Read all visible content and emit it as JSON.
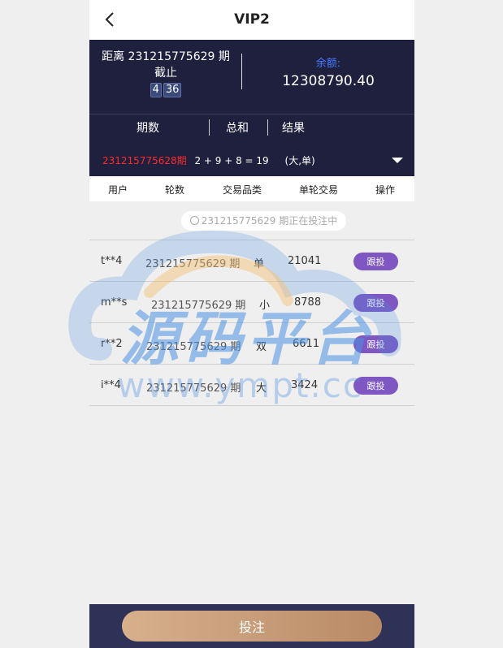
{
  "header": {
    "title": "VIP2"
  },
  "info": {
    "countdown_line1": "距离 231215775629 期",
    "countdown_line2": "截止",
    "timer_min": "4",
    "timer_sec": "36",
    "balance_label": "余额:",
    "balance_value": "12308790.40"
  },
  "result": {
    "headers": [
      "期数",
      "总和",
      "结果"
    ],
    "period": "231215775628期",
    "sum_expr": "2 + 9 + 8 = 19",
    "outcome": "(大,单)"
  },
  "columns": [
    "用户",
    "轮数",
    "交易品类",
    "单轮交易",
    "操作"
  ],
  "status": "231215775629 期正在投注中",
  "rows": [
    {
      "user": "t**4",
      "period": "231215775629 期",
      "type": "单",
      "amount": "21041",
      "action": "跟投"
    },
    {
      "user": "m**s",
      "period": "231215775629 期",
      "type": "小",
      "amount": "8788",
      "action": "跟投"
    },
    {
      "user": "r**2",
      "period": "231215775629 期",
      "type": "双",
      "amount": "6611",
      "action": "跟投"
    },
    {
      "user": "i**4",
      "period": "231215775629 期",
      "type": "大",
      "amount": "3424",
      "action": "跟投"
    }
  ],
  "footer": {
    "submit": "投注"
  },
  "watermark": {
    "text": "源码平台",
    "url": "www.ympt.cc"
  },
  "colors": {
    "accent": "#7e57c2",
    "dark": "#1f1f3e",
    "gold": "#c9a07a",
    "red": "#ff2b2b"
  }
}
